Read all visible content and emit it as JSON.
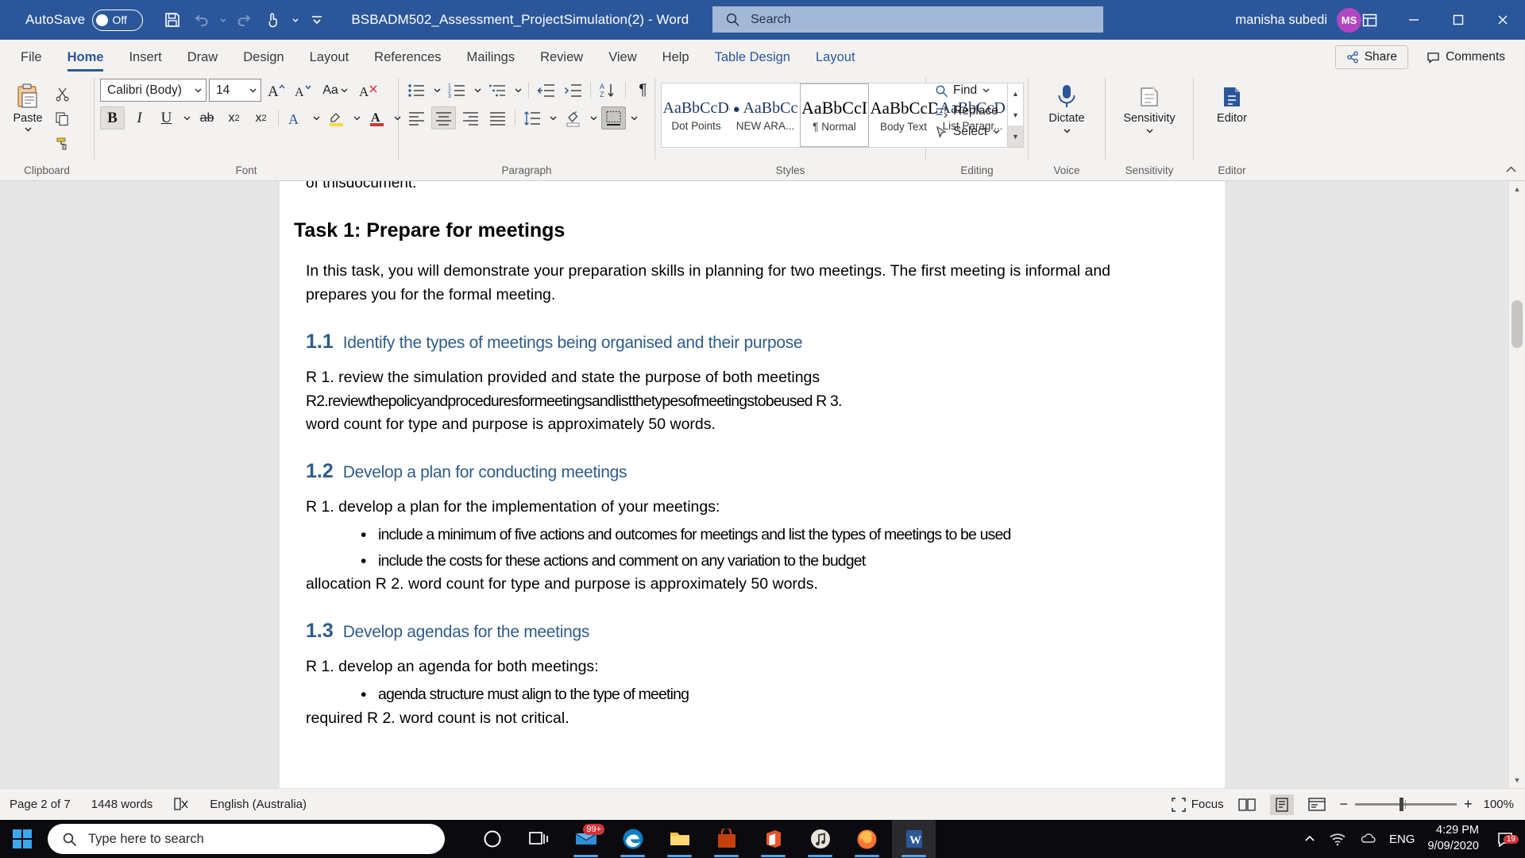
{
  "titlebar": {
    "autosave_label": "AutoSave",
    "autosave_state": "Off",
    "document_title": "BSBADM502_Assessment_ProjectSimulation(2)  -  Word",
    "search_placeholder": "Search",
    "user_name": "manisha subedi",
    "user_initials": "MS"
  },
  "tabs": [
    {
      "label": "File",
      "state": "normal"
    },
    {
      "label": "Home",
      "state": "active"
    },
    {
      "label": "Insert",
      "state": "normal"
    },
    {
      "label": "Draw",
      "state": "normal"
    },
    {
      "label": "Design",
      "state": "normal"
    },
    {
      "label": "Layout",
      "state": "normal"
    },
    {
      "label": "References",
      "state": "normal"
    },
    {
      "label": "Mailings",
      "state": "normal"
    },
    {
      "label": "Review",
      "state": "normal"
    },
    {
      "label": "View",
      "state": "normal"
    },
    {
      "label": "Help",
      "state": "normal"
    },
    {
      "label": "Table Design",
      "state": "contextual"
    },
    {
      "label": "Layout",
      "state": "contextual"
    }
  ],
  "tabbar_right": {
    "share_label": "Share",
    "comments_label": "Comments"
  },
  "ribbon": {
    "clipboard": {
      "label": "Clipboard",
      "paste_label": "Paste",
      "cut_name": "cut-icon",
      "copy_name": "copy-icon",
      "format_painter_name": "format-painter-icon"
    },
    "font": {
      "label": "Font",
      "font_name": "Calibri (Body)",
      "font_size": "14",
      "grow_label": "A",
      "shrink_label": "A",
      "change_case_label": "Aa",
      "clear_format_label": "A",
      "bold_label": "B",
      "italic_label": "I",
      "underline_label": "U",
      "strike_label": "ab",
      "subscript_label": "x",
      "subscript_sub": "2",
      "superscript_label": "x",
      "superscript_sup": "2",
      "text_effects_label": "A",
      "highlight_label": "A",
      "font_color_label": "A"
    },
    "paragraph": {
      "label": "Paragraph",
      "bullets_name": "bullets-icon",
      "numbering_name": "numbering-icon",
      "multilevel_name": "multilevel-list-icon",
      "decrease_indent_name": "decrease-indent-icon",
      "increase_indent_name": "increase-indent-icon",
      "sort_label": "A\nZ",
      "show_marks_label": "¶",
      "align_left_name": "align-left-icon",
      "align_center_name": "align-center-icon",
      "align_right_name": "align-right-icon",
      "justify_name": "justify-icon",
      "line_spacing_name": "line-spacing-icon",
      "shading_name": "shading-icon",
      "borders_name": "borders-icon"
    },
    "styles": {
      "label": "Styles",
      "items": [
        {
          "preview": "AaBbCcDе",
          "name": "Dot Points",
          "selected": false,
          "bulleted": false
        },
        {
          "preview": "AaBbCc",
          "name": "NEW ARA...",
          "selected": false,
          "bulleted": true
        },
        {
          "preview": "AaBbCcI",
          "name": "¶ Normal",
          "selected": true,
          "bulleted": false
        },
        {
          "preview": "AaBbCcD",
          "name": "Body Text",
          "selected": false,
          "bulleted": false
        },
        {
          "preview": "AaBbCcDе",
          "name": "List Paragr...",
          "selected": false,
          "bulleted": false
        }
      ]
    },
    "editing": {
      "label": "Editing",
      "find_label": "Find",
      "replace_label": "Replace",
      "select_label": "Select"
    },
    "voice": {
      "label": "Voice",
      "dictate_label": "Dictate"
    },
    "sensitivity": {
      "label": "Sensitivity",
      "button_label": "Sensitivity"
    },
    "editor": {
      "label": "Editor",
      "button_label": "Editor"
    }
  },
  "document": {
    "partial_top_line": "of thisdocument.",
    "heading": "Task 1: Prepare for meetings",
    "intro": "In this task, you will demonstrate your preparation skills in planning for two meetings. The first meeting is informal and prepares you for the formal meeting.",
    "sections": [
      {
        "number": "1.1",
        "title": "Identify the types of meetings being organised and their purpose",
        "lines": [
          "R 1. review the simulation provided and state the purpose of both meetings",
          "R2.reviewthepolicyandproceduresformeetingsandlistthetypesofmeetingstobeused R 3.",
          "word count for type and purpose is approximately 50 words."
        ],
        "bullets": []
      },
      {
        "number": "1.2",
        "title": "Develop a plan for conducting meetings",
        "lines": [
          "R 1. develop a plan for the implementation of your meetings:"
        ],
        "bullets": [
          "include a minimum of five actions and outcomes for meetings and list the types of meetings to be used",
          "include the costs for these actions and comment on any variation to the budget"
        ],
        "trailing": "allocation R 2. word count for type and purpose is approximately 50 words."
      },
      {
        "number": "1.3",
        "title": "Develop agendas for the meetings",
        "lines": [
          "R 1. develop an agenda for both meetings:"
        ],
        "bullets": [
          "agenda structure must align to the type of meeting"
        ],
        "trailing": "required R 2. word count is not critical."
      }
    ]
  },
  "statusbar": {
    "page": "Page 2 of 7",
    "words": "1448 words",
    "proofing_icon": "proofing-errors-icon",
    "language": "English (Australia)",
    "focus_label": "Focus",
    "views": [
      "read-mode-icon",
      "print-layout-icon",
      "web-layout-icon"
    ],
    "zoom_out": "−",
    "zoom_in": "+",
    "zoom_level": "100%"
  },
  "taskbar": {
    "start_name": "windows-start-icon",
    "search_placeholder": "Type here to search",
    "cortana_name": "cortana-icon",
    "taskview_name": "task-view-icon",
    "apps": [
      {
        "name": "mail-icon",
        "badge": "99+"
      },
      {
        "name": "edge-icon",
        "badge": ""
      },
      {
        "name": "file-explorer-icon",
        "badge": ""
      },
      {
        "name": "store-icon",
        "badge": ""
      },
      {
        "name": "office-icon",
        "badge": ""
      },
      {
        "name": "music-icon",
        "badge": ""
      },
      {
        "name": "firefox-icon",
        "badge": ""
      },
      {
        "name": "word-icon",
        "badge": ""
      }
    ],
    "tray": {
      "chevron_name": "show-hidden-icons-icon",
      "network_name": "wifi-icon",
      "onedrive_name": "onedrive-icon",
      "language": "ENG",
      "time": "4:29 PM",
      "date": "9/09/2020",
      "notification_count": "19"
    }
  },
  "colors": {
    "word_blue": "#2b579a",
    "accent_blue": "#2e5c8a",
    "ribbon_bg": "#f3f2f1"
  }
}
